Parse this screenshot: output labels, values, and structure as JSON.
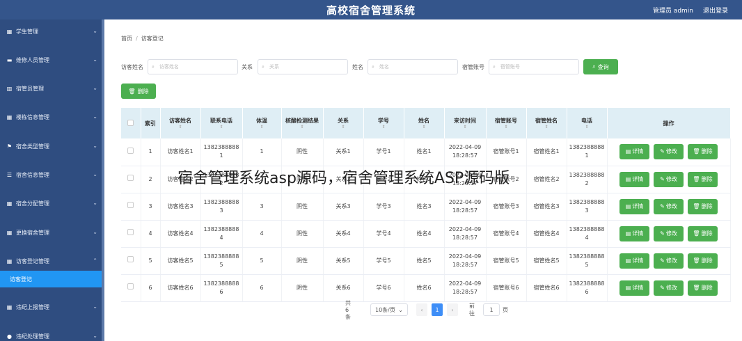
{
  "header": {
    "title": "高校宿舍管理系统",
    "user": "管理员 admin",
    "logout": "退出登录"
  },
  "sidebar": {
    "items": [
      {
        "label": "学生管理",
        "icon": "grid-icon"
      },
      {
        "label": "维修人员管理",
        "icon": "briefcase-icon"
      },
      {
        "label": "宿管员管理",
        "icon": "building-icon"
      },
      {
        "label": "楼栋信息管理",
        "icon": "grid-icon"
      },
      {
        "label": "宿舍类型管理",
        "icon": "flag-icon"
      },
      {
        "label": "宿舍信息管理",
        "icon": "list-icon"
      },
      {
        "label": "宿舍分配管理",
        "icon": "grid-icon"
      },
      {
        "label": "更换宿舍管理",
        "icon": "grid-icon"
      },
      {
        "label": "访客登记管理",
        "icon": "grid-icon"
      },
      {
        "label": "违纪上报管理",
        "icon": "grid-icon"
      },
      {
        "label": "违纪处理管理",
        "icon": "user-icon"
      }
    ],
    "active_sub": "访客登记"
  },
  "breadcrumb": {
    "home": "首页",
    "sep": "/",
    "current": "访客登记"
  },
  "search": {
    "visitor_name_label": "访客姓名",
    "visitor_name_placeholder": "访客姓名",
    "relation_label": "关系",
    "relation_placeholder": "关系",
    "name_label": "姓名",
    "name_placeholder": "姓名",
    "dorm_account_label": "宿管账号",
    "dorm_account_placeholder": "宿管账号",
    "query_button": "查询"
  },
  "toolbar": {
    "delete_button": "删除"
  },
  "table": {
    "headers": [
      "索引",
      "访客姓名",
      "联系电话",
      "体温",
      "核酸检测结果",
      "关系",
      "学号",
      "姓名",
      "来访时间",
      "宿管账号",
      "宿管姓名",
      "电话",
      "操作"
    ],
    "rows": [
      {
        "index": "1",
        "visitor": "访客姓名1",
        "phone_a": "1382388888",
        "phone_b": "1",
        "temp": "1",
        "result": "阴性",
        "relation": "关系1",
        "sid": "学号1",
        "name": "姓名1",
        "date": "2022-04-09",
        "time": "18:28:57",
        "account": "宿管账号1",
        "mname": "宿管姓名1",
        "tel_a": "1382388888",
        "tel_b": "1"
      },
      {
        "index": "2",
        "visitor": "访客姓名2",
        "phone_a": "1382388888",
        "phone_b": "2",
        "temp": "2",
        "result": "阴性",
        "relation": "关系2",
        "sid": "学号2",
        "name": "姓名2",
        "date": "2022-04-09",
        "time": "18:28:57",
        "account": "宿管账号2",
        "mname": "宿管姓名2",
        "tel_a": "1382388888",
        "tel_b": "2"
      },
      {
        "index": "3",
        "visitor": "访客姓名3",
        "phone_a": "1382388888",
        "phone_b": "3",
        "temp": "3",
        "result": "阴性",
        "relation": "关系3",
        "sid": "学号3",
        "name": "姓名3",
        "date": "2022-04-09",
        "time": "18:28:57",
        "account": "宿管账号3",
        "mname": "宿管姓名3",
        "tel_a": "1382388888",
        "tel_b": "3"
      },
      {
        "index": "4",
        "visitor": "访客姓名4",
        "phone_a": "1382388888",
        "phone_b": "4",
        "temp": "4",
        "result": "阴性",
        "relation": "关系4",
        "sid": "学号4",
        "name": "姓名4",
        "date": "2022-04-09",
        "time": "18:28:57",
        "account": "宿管账号4",
        "mname": "宿管姓名4",
        "tel_a": "1382388888",
        "tel_b": "4"
      },
      {
        "index": "5",
        "visitor": "访客姓名5",
        "phone_a": "1382388888",
        "phone_b": "5",
        "temp": "5",
        "result": "阴性",
        "relation": "关系5",
        "sid": "学号5",
        "name": "姓名5",
        "date": "2022-04-09",
        "time": "18:28:57",
        "account": "宿管账号5",
        "mname": "宿管姓名5",
        "tel_a": "1382388888",
        "tel_b": "5"
      },
      {
        "index": "6",
        "visitor": "访客姓名6",
        "phone_a": "1382388888",
        "phone_b": "6",
        "temp": "6",
        "result": "阴性",
        "relation": "关系6",
        "sid": "学号6",
        "name": "姓名6",
        "date": "2022-04-09",
        "time": "18:28:57",
        "account": "宿管账号6",
        "mname": "宿管姓名6",
        "tel_a": "1382388888",
        "tel_b": "6"
      }
    ],
    "ops": {
      "detail": "详情",
      "edit": "修改",
      "delete": "删除"
    }
  },
  "pagination": {
    "total": "共 6 条",
    "page_size": "10条/页",
    "current": "1",
    "goto_label": "前往",
    "goto_value": "1",
    "page_unit": "页"
  },
  "watermark": "宿舍管理系统asp源码，宿舍管理系统ASP源码版",
  "colors": {
    "header": "#34558b",
    "sidebar": "#2f4d80",
    "active": "#2196f3",
    "button": "#4caf50",
    "table_header": "#dfeef5"
  }
}
